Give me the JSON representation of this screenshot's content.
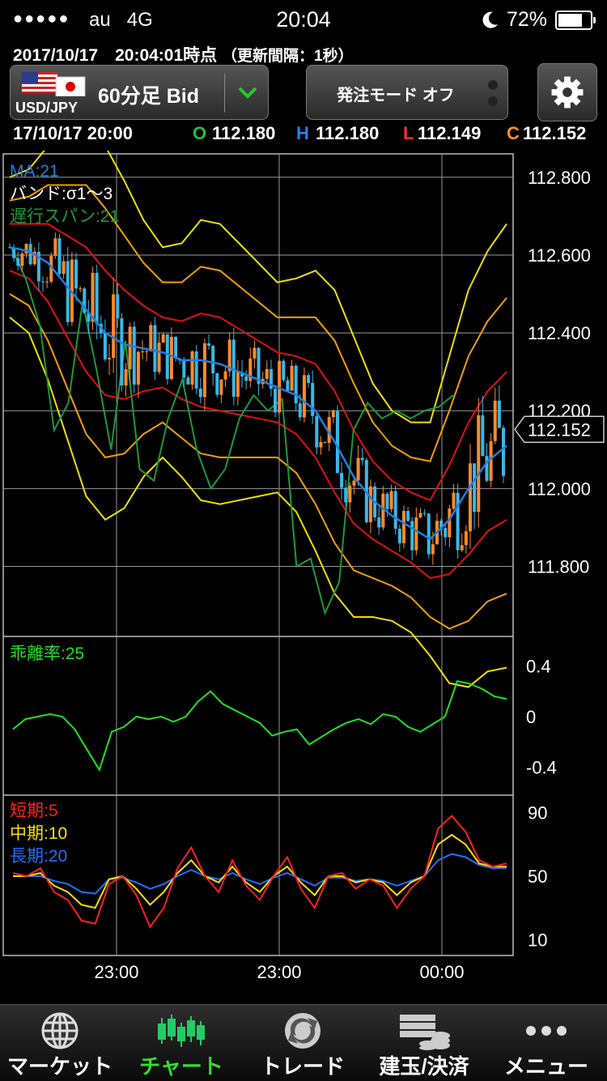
{
  "status_bar": {
    "signal_dots": "●●●●●",
    "carrier": "au",
    "network": "4G",
    "time": "20:04",
    "moon_icon": "moon-icon",
    "battery": "72%",
    "battery_level": 0.72
  },
  "info": {
    "timestamp": "2017/10/17　20:04:01時点",
    "update_interval": "（更新間隔：1秒）"
  },
  "pair_selector": {
    "pair": "USD/JPY",
    "timeframe": "60分足 Bid",
    "icons": [
      "us-flag-icon",
      "jp-flag-icon",
      "chevron-down-icon"
    ]
  },
  "order_mode": {
    "label": "発注モード オフ"
  },
  "settings": {
    "icon": "gear-icon"
  },
  "ohlc": {
    "time": "17/10/17 20:00",
    "o_label": "O",
    "o": "112.180",
    "h_label": "H",
    "h": "112.180",
    "l_label": "L",
    "l": "112.149",
    "c_label": "C",
    "c": "112.152"
  },
  "chart_data": {
    "type": "candlestick",
    "x_ticks": [
      "23:00",
      "23:00",
      "00:00"
    ],
    "main_panel": {
      "legend": [
        "MA:21",
        "バンド:σ1〜3",
        "遅行スパン:21"
      ],
      "y_ticks": [
        "112.800",
        "112.600",
        "112.400",
        "112.200",
        "112.000",
        "111.800"
      ],
      "ylim": [
        111.62,
        112.86
      ],
      "current_price": "112.152",
      "colors": {
        "ma": "#1f7fe0",
        "band1": "#e01010",
        "band2": "#f0a000",
        "band3": "#f0e000",
        "lagging": "#1a9a3a",
        "candle_up": "#ff8a2a",
        "candle_down": "#38b8e8"
      },
      "ma": [
        112.62,
        112.61,
        112.58,
        112.52,
        112.46,
        112.4,
        112.37,
        112.36,
        112.35,
        112.33,
        112.33,
        112.32,
        112.3,
        112.28,
        112.26,
        112.24,
        112.2,
        112.12,
        112.03,
        111.97,
        111.93,
        111.9,
        111.87,
        111.92,
        112.0,
        112.07,
        112.11
      ],
      "band_sd": [
        0.06,
        0.07,
        0.1,
        0.13,
        0.16,
        0.16,
        0.14,
        0.11,
        0.09,
        0.1,
        0.12,
        0.12,
        0.11,
        0.1,
        0.09,
        0.1,
        0.12,
        0.13,
        0.12,
        0.1,
        0.09,
        0.09,
        0.1,
        0.14,
        0.17,
        0.18,
        0.19
      ],
      "lagging": [
        112.62,
        112.54,
        112.42,
        112.15,
        112.22,
        112.48,
        112.3,
        112.1,
        112.38,
        112.05,
        112.02,
        112.18,
        112.28,
        112.1,
        112.0,
        112.05,
        112.18,
        112.24,
        112.2,
        112.23,
        111.8,
        111.82,
        111.68,
        111.76,
        112.15,
        112.22,
        112.18,
        112.2,
        112.18,
        112.2,
        112.21,
        112.24
      ]
    },
    "deviation_panel": {
      "label": "乖離率:25",
      "y_ticks": [
        "0.4",
        "0",
        "-0.4"
      ],
      "ylim": [
        -0.62,
        0.62
      ],
      "color": "#20e020",
      "values": [
        -0.1,
        -0.02,
        0.0,
        0.02,
        0.0,
        -0.1,
        -0.26,
        -0.42,
        -0.12,
        -0.08,
        0.0,
        -0.02,
        0.0,
        -0.04,
        0.0,
        0.12,
        0.2,
        0.1,
        0.05,
        0.0,
        -0.05,
        -0.15,
        -0.12,
        -0.1,
        -0.22,
        -0.16,
        -0.1,
        -0.05,
        -0.02,
        -0.06,
        0.02,
        0.0,
        -0.08,
        -0.12,
        -0.06,
        0.0,
        0.28,
        0.26,
        0.22,
        0.16,
        0.14
      ]
    },
    "rsi_panel": {
      "labels": [
        {
          "text": "短期:5",
          "color": "#ff2020"
        },
        {
          "text": "中期:10",
          "color": "#ffe000"
        },
        {
          "text": "長期:20",
          "color": "#2070ff"
        }
      ],
      "y_ticks": [
        "90",
        "50",
        "10"
      ],
      "ylim": [
        0,
        100
      ],
      "short": [
        52,
        50,
        55,
        40,
        35,
        22,
        20,
        45,
        50,
        38,
        18,
        30,
        55,
        68,
        50,
        40,
        60,
        44,
        35,
        50,
        62,
        42,
        30,
        50,
        52,
        42,
        48,
        44,
        30,
        42,
        50,
        80,
        88,
        78,
        60,
        56,
        58
      ],
      "mid": [
        50,
        50,
        52,
        44,
        40,
        32,
        30,
        48,
        50,
        42,
        32,
        40,
        52,
        60,
        50,
        46,
        56,
        46,
        40,
        50,
        56,
        46,
        38,
        50,
        50,
        46,
        48,
        46,
        38,
        46,
        50,
        70,
        76,
        70,
        58,
        56,
        56
      ],
      "long": [
        50,
        50,
        50,
        47,
        45,
        40,
        39,
        48,
        49,
        46,
        42,
        45,
        50,
        54,
        50,
        48,
        52,
        48,
        45,
        49,
        52,
        48,
        44,
        49,
        49,
        47,
        48,
        47,
        44,
        47,
        50,
        60,
        64,
        62,
        57,
        55,
        55
      ]
    }
  },
  "tabbar": {
    "tabs": [
      {
        "label": "マーケット",
        "icon": "globe-icon",
        "active": false
      },
      {
        "label": "チャート",
        "icon": "candlestick-chart-icon",
        "active": true
      },
      {
        "label": "トレード",
        "icon": "trade-arrows-icon",
        "active": false
      },
      {
        "label": "建玉/決済",
        "icon": "positions-coins-icon",
        "active": false
      },
      {
        "label": "メニュー",
        "icon": "more-dots-icon",
        "active": false
      }
    ],
    "active_color": "#30e030"
  }
}
